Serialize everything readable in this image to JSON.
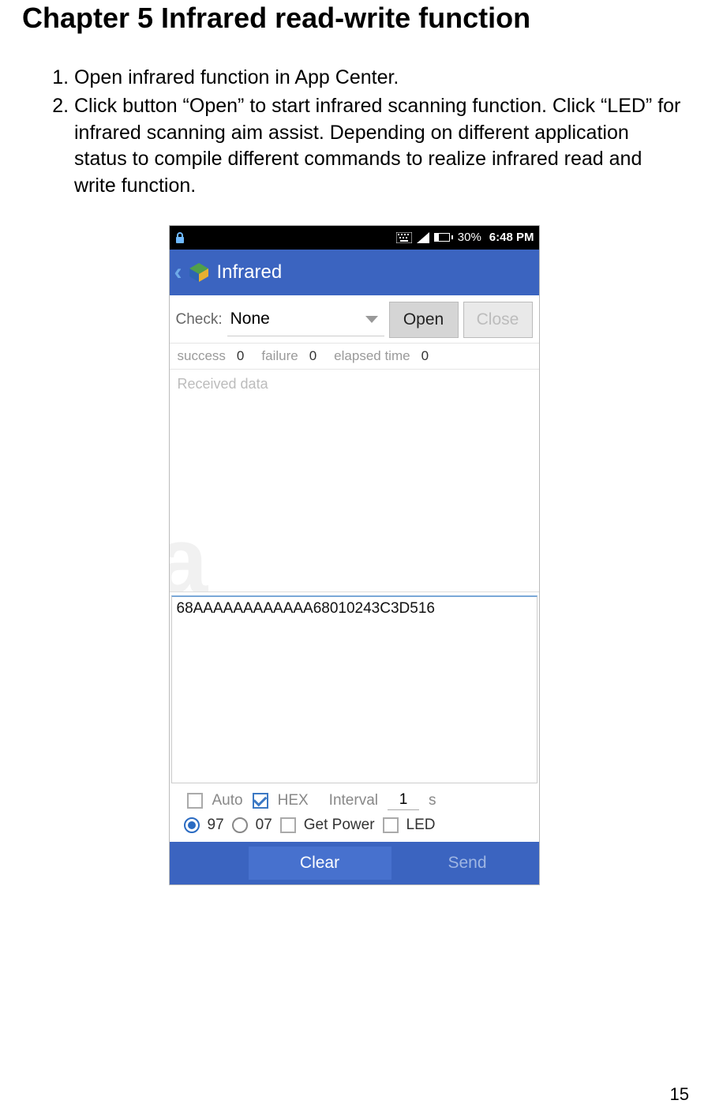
{
  "doc": {
    "chapter_title": "Chapter 5 Infrared read-write function",
    "instructions": [
      "Open infrared function in App Center.",
      "Click button “Open” to start infrared scanning function. Click “LED” for infrared scanning aim assist. Depending on different application status to compile different commands to realize infrared read and write function."
    ],
    "page_number": "15"
  },
  "statusbar": {
    "battery_pct": "30%",
    "time": "6:48 PM"
  },
  "app": {
    "title": "Infrared",
    "check_label": "Check:",
    "check_value": "None",
    "open_label": "Open",
    "close_label": "Close",
    "stats": {
      "success_label": "success",
      "success_val": "0",
      "failure_label": "failure",
      "failure_val": "0",
      "elapsed_label": "elapsed time",
      "elapsed_val": "0"
    },
    "received_placeholder": "Received data",
    "send_value": "68AAAAAAAAAAAA68010243C3D516",
    "options": {
      "auto_label": "Auto",
      "hex_label": "HEX",
      "interval_label": "Interval",
      "interval_value": "1",
      "interval_unit": "s",
      "radio_97": "97",
      "radio_07": "07",
      "getpower_label": "Get Power",
      "led_label": "LED"
    },
    "buttons": {
      "clear": "Clear",
      "send": "Send"
    }
  }
}
